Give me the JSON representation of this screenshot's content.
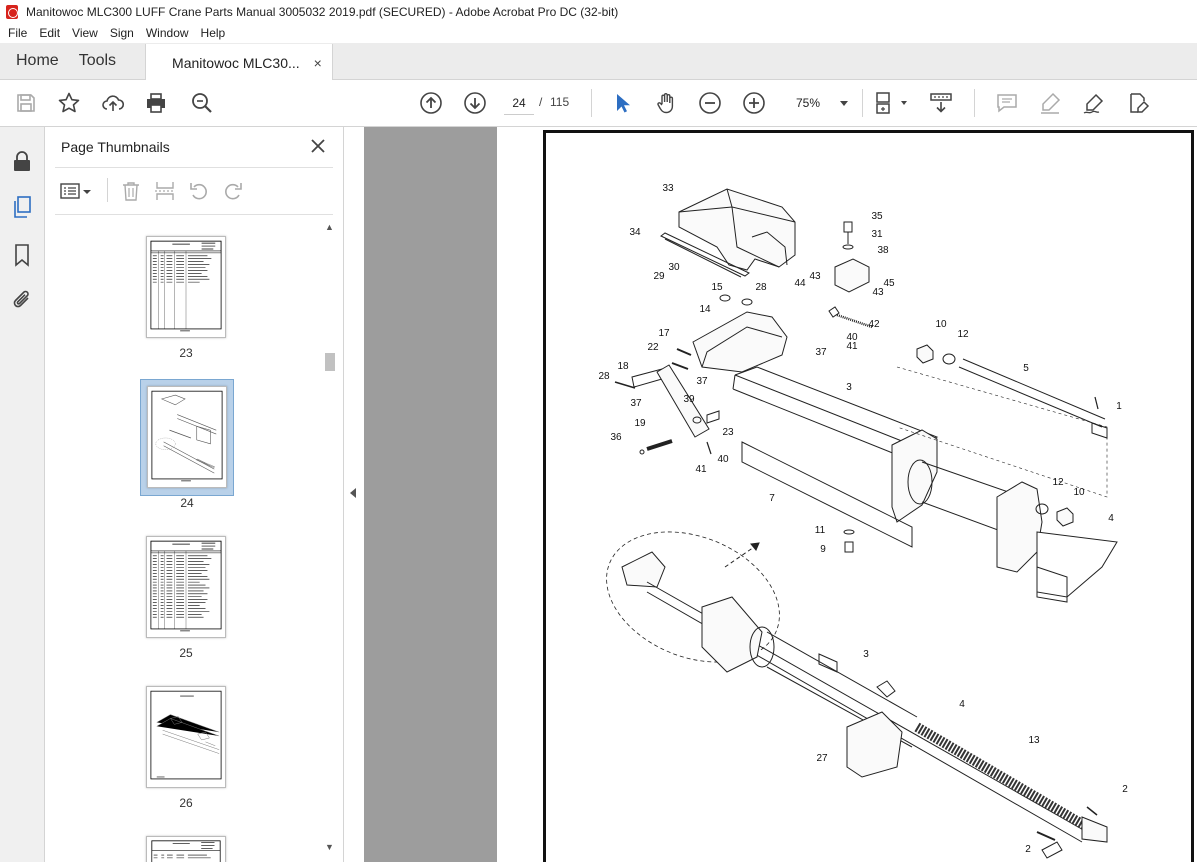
{
  "window": {
    "title": "Manitowoc MLC300 LUFF Crane Parts Manual 3005032 2019.pdf (SECURED) - Adobe Acrobat Pro DC (32-bit)"
  },
  "menu": [
    "File",
    "Edit",
    "View",
    "Sign",
    "Window",
    "Help"
  ],
  "tabs": {
    "home": "Home",
    "tools": "Tools",
    "document": "Manitowoc MLC30...",
    "close_glyph": "×"
  },
  "toolbar": {
    "current_page": "24",
    "page_separator": "/",
    "total_pages": "115",
    "zoom": "75%",
    "icons": [
      "save-icon",
      "bookmark-star-icon",
      "upload-icon",
      "print-icon",
      "find-zoom-icon",
      "page-up-icon",
      "page-down-icon",
      "select-cursor-icon",
      "hand-icon",
      "zoom-out-icon",
      "zoom-in-icon",
      "page-layout-icon",
      "scroll-mode-icon",
      "comment-icon",
      "highlight-icon",
      "sign-icon",
      "edit-pdf-icon"
    ]
  },
  "left_rail": {
    "icons": [
      "lock-icon",
      "page-thumbnails-icon",
      "bookmarks-icon",
      "attachments-icon"
    ]
  },
  "thumbnails_panel": {
    "title": "Page Thumbnails",
    "pages": [
      {
        "label": "23",
        "kind": "parts-list"
      },
      {
        "label": "24",
        "kind": "drawing",
        "selected": true
      },
      {
        "label": "25",
        "kind": "parts-list"
      },
      {
        "label": "26",
        "kind": "drawing"
      }
    ]
  },
  "drawing": {
    "callouts": [
      "33",
      "35",
      "34",
      "31",
      "38",
      "30",
      "29",
      "43",
      "44",
      "45",
      "43",
      "15",
      "28",
      "14",
      "42",
      "10",
      "12",
      "17",
      "40",
      "41",
      "22",
      "37",
      "5",
      "18",
      "28",
      "37",
      "3",
      "1",
      "37",
      "39",
      "19",
      "23",
      "36",
      "40",
      "41",
      "7",
      "12",
      "10",
      "4",
      "11",
      "9",
      "3",
      "4",
      "13",
      "27",
      "2",
      "2"
    ]
  }
}
